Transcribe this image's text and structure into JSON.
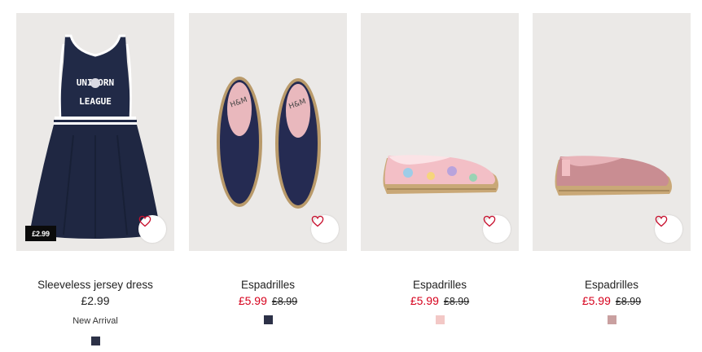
{
  "products": [
    {
      "title": "Sleeveless jersey dress",
      "price": "£2.99",
      "price_tag": "£2.99",
      "marker": "New Arrival",
      "print_text": [
        "UNICORN",
        "LEAGUE"
      ],
      "swatch_color": "#2c3147"
    },
    {
      "title": "Espadrilles",
      "sale_price": "£5.99",
      "old_price": "£8.99",
      "print_text": [
        "H&M",
        "H&M"
      ],
      "swatch_color": "#2c3147"
    },
    {
      "title": "Espadrilles",
      "sale_price": "£5.99",
      "old_price": "£8.99",
      "swatch_color": "#f3c8c6"
    },
    {
      "title": "Espadrilles",
      "sale_price": "£5.99",
      "old_price": "£8.99",
      "swatch_color": "#c9a0a0"
    }
  ],
  "colors": {
    "sale": "#d6001c",
    "favourite": "#c8102e",
    "image_bg": "#ebe9e7"
  },
  "icons": {
    "favourite": "heart-icon"
  }
}
